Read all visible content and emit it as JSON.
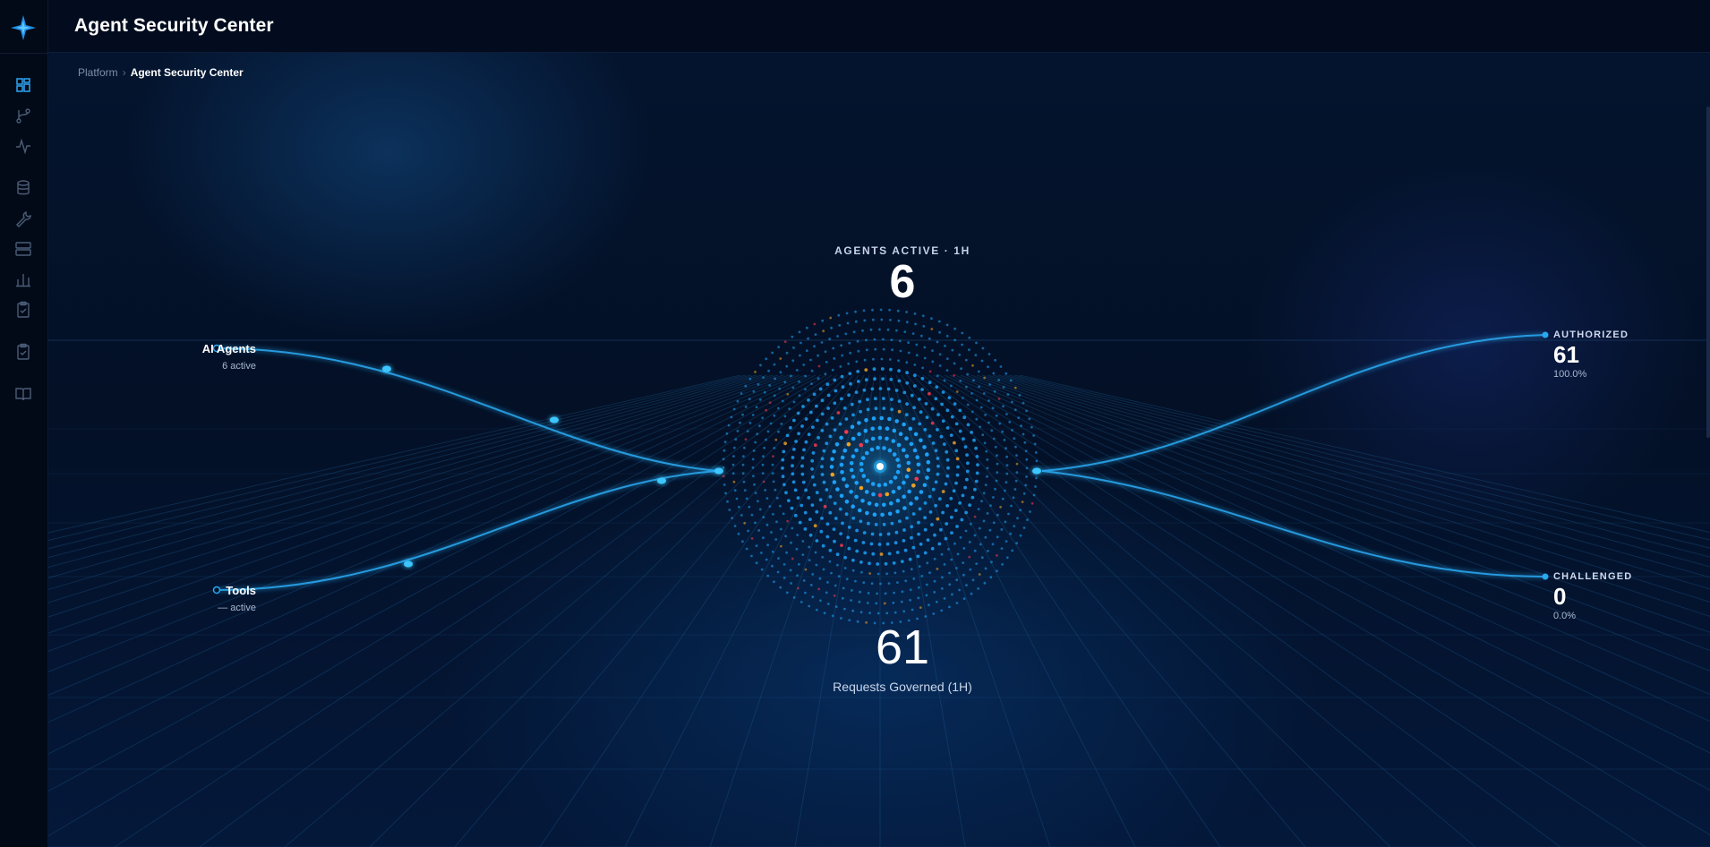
{
  "app": {
    "title": "Agent Security Center",
    "accent": "#1ea7ff"
  },
  "breadcrumb": {
    "parent": "Platform",
    "separator": "›",
    "current": "Agent Security Center"
  },
  "sidebar": {
    "items": [
      {
        "icon": "dashboard-icon",
        "active": true
      },
      {
        "icon": "git-branch-icon",
        "active": false
      },
      {
        "icon": "activity-icon",
        "active": false
      },
      {
        "icon": "database-icon",
        "active": false
      },
      {
        "icon": "wrench-icon",
        "active": false
      },
      {
        "icon": "server-icon",
        "active": false
      },
      {
        "icon": "bar-chart-icon",
        "active": false
      },
      {
        "icon": "clipboard-check-icon",
        "active": false
      },
      {
        "icon": "clipboard-check-2-icon",
        "active": false
      },
      {
        "icon": "book-icon",
        "active": false
      }
    ]
  },
  "hub": {
    "agents_label": "AGENTS ACTIVE · 1H",
    "agents_value": "6",
    "requests_value": "61",
    "requests_label": "Requests Governed (1H)"
  },
  "sources": [
    {
      "name": "AI Agents",
      "sub": "6 active"
    },
    {
      "name": "Tools",
      "sub": "— active"
    }
  ],
  "outcomes": [
    {
      "name": "AUTHORIZED",
      "value": "61",
      "pct": "100.0%"
    },
    {
      "name": "CHALLENGED",
      "value": "0",
      "pct": "0.0%"
    }
  ],
  "colors": {
    "dot_primary": "#1ea7ff",
    "dot_warning": "#f5a623",
    "dot_alert": "#ff3b4f",
    "line": "#2aa8f0"
  }
}
